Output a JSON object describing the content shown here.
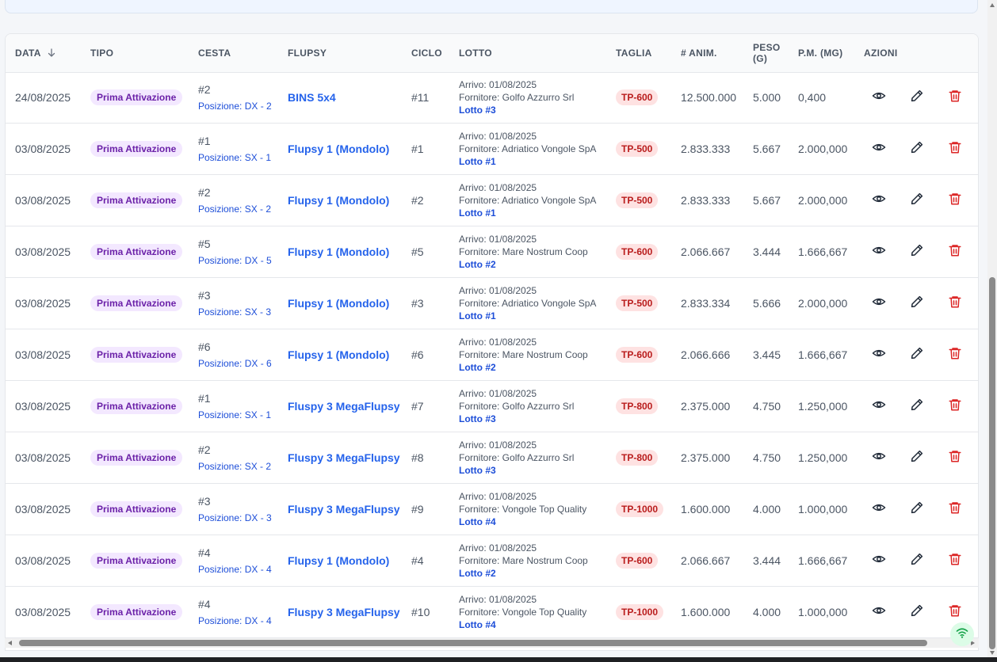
{
  "table": {
    "headers": {
      "data": "DATA",
      "tipo": "TIPO",
      "cesta": "CESTA",
      "flupsy": "FLUPSY",
      "ciclo": "CICLO",
      "lotto": "LOTTO",
      "taglia": "TAGLIA",
      "anim": "# ANIM.",
      "peso_line1": "PESO",
      "peso_line2": "(G)",
      "pm": "P.M. (MG)",
      "azioni": "AZIONI"
    },
    "sort_icon": "arrow-down-icon",
    "rows": [
      {
        "date": "24/08/2025",
        "type": "Prima Attivazione",
        "basket": "#2",
        "position": "Posizione: DX - 2",
        "flupsy": "BINS 5x4",
        "cycle": "#11",
        "arrival": "Arrivo: 01/08/2025",
        "supplier": "Fornitore: Golfo Azzurro Srl",
        "lot": "Lotto #3",
        "size": "TP-600",
        "animals": "12.500.000",
        "weight": "5.000",
        "avg_weight": "0,400"
      },
      {
        "date": "03/08/2025",
        "type": "Prima Attivazione",
        "basket": "#1",
        "position": "Posizione: SX - 1",
        "flupsy": "Flupsy 1 (Mondolo)",
        "cycle": "#1",
        "arrival": "Arrivo: 01/08/2025",
        "supplier": "Fornitore: Adriatico Vongole SpA",
        "lot": "Lotto #1",
        "size": "TP-500",
        "animals": "2.833.333",
        "weight": "5.667",
        "avg_weight": "2.000,000"
      },
      {
        "date": "03/08/2025",
        "type": "Prima Attivazione",
        "basket": "#2",
        "position": "Posizione: SX - 2",
        "flupsy": "Flupsy 1 (Mondolo)",
        "cycle": "#2",
        "arrival": "Arrivo: 01/08/2025",
        "supplier": "Fornitore: Adriatico Vongole SpA",
        "lot": "Lotto #1",
        "size": "TP-500",
        "animals": "2.833.333",
        "weight": "5.667",
        "avg_weight": "2.000,000"
      },
      {
        "date": "03/08/2025",
        "type": "Prima Attivazione",
        "basket": "#5",
        "position": "Posizione: DX - 5",
        "flupsy": "Flupsy 1 (Mondolo)",
        "cycle": "#5",
        "arrival": "Arrivo: 01/08/2025",
        "supplier": "Fornitore: Mare Nostrum Coop",
        "lot": "Lotto #2",
        "size": "TP-600",
        "animals": "2.066.667",
        "weight": "3.444",
        "avg_weight": "1.666,667"
      },
      {
        "date": "03/08/2025",
        "type": "Prima Attivazione",
        "basket": "#3",
        "position": "Posizione: SX - 3",
        "flupsy": "Flupsy 1 (Mondolo)",
        "cycle": "#3",
        "arrival": "Arrivo: 01/08/2025",
        "supplier": "Fornitore: Adriatico Vongole SpA",
        "lot": "Lotto #1",
        "size": "TP-500",
        "animals": "2.833.334",
        "weight": "5.666",
        "avg_weight": "2.000,000"
      },
      {
        "date": "03/08/2025",
        "type": "Prima Attivazione",
        "basket": "#6",
        "position": "Posizione: DX - 6",
        "flupsy": "Flupsy 1 (Mondolo)",
        "cycle": "#6",
        "arrival": "Arrivo: 01/08/2025",
        "supplier": "Fornitore: Mare Nostrum Coop",
        "lot": "Lotto #2",
        "size": "TP-600",
        "animals": "2.066.666",
        "weight": "3.445",
        "avg_weight": "1.666,667"
      },
      {
        "date": "03/08/2025",
        "type": "Prima Attivazione",
        "basket": "#1",
        "position": "Posizione: SX - 1",
        "flupsy": "Fluspy 3 MegaFlupsy",
        "cycle": "#7",
        "arrival": "Arrivo: 01/08/2025",
        "supplier": "Fornitore: Golfo Azzurro Srl",
        "lot": "Lotto #3",
        "size": "TP-800",
        "animals": "2.375.000",
        "weight": "4.750",
        "avg_weight": "1.250,000"
      },
      {
        "date": "03/08/2025",
        "type": "Prima Attivazione",
        "basket": "#2",
        "position": "Posizione: SX - 2",
        "flupsy": "Fluspy 3 MegaFlupsy",
        "cycle": "#8",
        "arrival": "Arrivo: 01/08/2025",
        "supplier": "Fornitore: Golfo Azzurro Srl",
        "lot": "Lotto #3",
        "size": "TP-800",
        "animals": "2.375.000",
        "weight": "4.750",
        "avg_weight": "1.250,000"
      },
      {
        "date": "03/08/2025",
        "type": "Prima Attivazione",
        "basket": "#3",
        "position": "Posizione: DX - 3",
        "flupsy": "Fluspy 3 MegaFlupsy",
        "cycle": "#9",
        "arrival": "Arrivo: 01/08/2025",
        "supplier": "Fornitore: Vongole Top Quality",
        "lot": "Lotto #4",
        "size": "TP-1000",
        "animals": "1.600.000",
        "weight": "4.000",
        "avg_weight": "1.000,000"
      },
      {
        "date": "03/08/2025",
        "type": "Prima Attivazione",
        "basket": "#4",
        "position": "Posizione: DX - 4",
        "flupsy": "Flupsy 1 (Mondolo)",
        "cycle": "#4",
        "arrival": "Arrivo: 01/08/2025",
        "supplier": "Fornitore: Mare Nostrum Coop",
        "lot": "Lotto #2",
        "size": "TP-600",
        "animals": "2.066.667",
        "weight": "3.444",
        "avg_weight": "1.666,667"
      },
      {
        "date": "03/08/2025",
        "type": "Prima Attivazione",
        "basket": "#4",
        "position": "Posizione: DX - 4",
        "flupsy": "Fluspy 3 MegaFlupsy",
        "cycle": "#10",
        "arrival": "Arrivo: 01/08/2025",
        "supplier": "Fornitore: Vongole Top Quality",
        "lot": "Lotto #4",
        "size": "TP-1000",
        "animals": "1.600.000",
        "weight": "4.000",
        "avg_weight": "1.000,000"
      }
    ]
  },
  "actions": {
    "view_icon": "eye-icon",
    "edit_icon": "pencil-icon",
    "delete_icon": "trash-icon"
  },
  "colors": {
    "type_badge_bg": "#f3e8ff",
    "type_badge_text": "#6b21a8",
    "size_badge_bg": "#fee2e2",
    "size_badge_text": "#b91c1c",
    "link": "#2563eb",
    "delete": "#dc2626"
  },
  "status": {
    "icon": "wifi-icon"
  }
}
